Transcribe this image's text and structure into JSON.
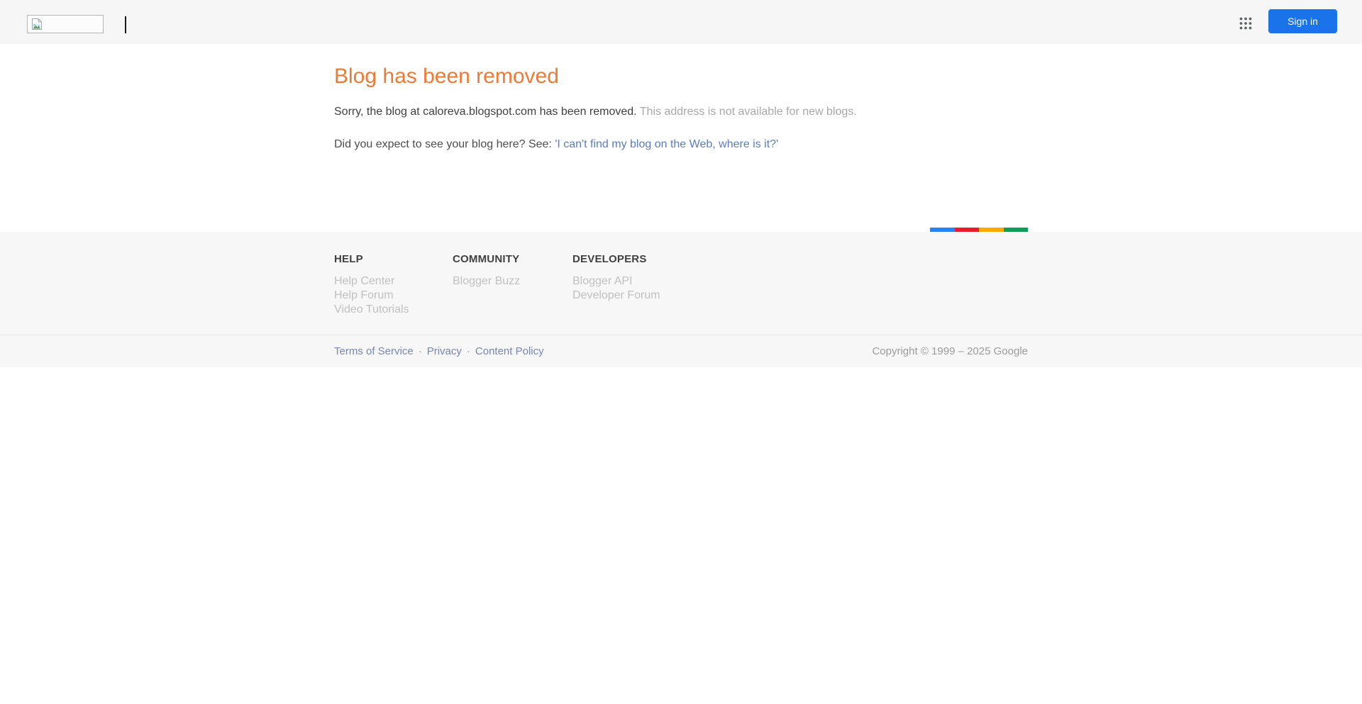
{
  "header": {
    "logo": {
      "icon": "broken-image-icon"
    },
    "apps_button": {
      "icon": "google-apps-grid-icon",
      "dot_color": "#5f6368"
    },
    "sign_in": {
      "label": "Sign in",
      "bg_color": "#1a73e8",
      "text_color": "#ffffff"
    }
  },
  "main": {
    "title": "Blog has been removed",
    "title_color": "#ee7a34",
    "message": {
      "primary": "Sorry, the blog at caloreva.blogspot.com has been removed.",
      "secondary": "This address is not available for new blogs."
    },
    "prompt": {
      "text": "Did you expect to see your blog here? See: ",
      "link_label": "'I can't find my blog on the Web, where is it?'",
      "link_color": "#5b7db8"
    }
  },
  "footer": {
    "stripe_colors": [
      "#2484f5",
      "#ea1b2d",
      "#fbab00",
      "#0d9d58"
    ],
    "columns": [
      {
        "heading": "HELP",
        "links": [
          "Help Center",
          "Help Forum",
          "Video Tutorials"
        ]
      },
      {
        "heading": "COMMUNITY",
        "links": [
          "Blogger Buzz"
        ]
      },
      {
        "heading": "DEVELOPERS",
        "links": [
          "Blogger API",
          "Developer Forum"
        ]
      }
    ]
  },
  "bottom_bar": {
    "links": [
      "Terms of Service",
      "Privacy",
      "Content Policy"
    ],
    "separator": "·",
    "copyright": "Copyright © 1999 – 2025 Google"
  }
}
